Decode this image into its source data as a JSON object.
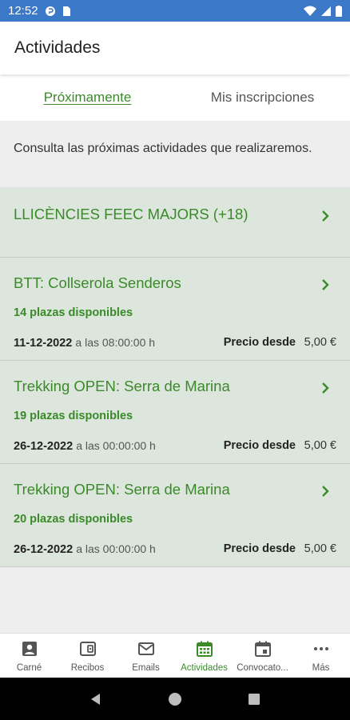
{
  "status": {
    "time": "12:52"
  },
  "app_bar": {
    "title": "Actividades"
  },
  "tabs": [
    {
      "label": "Próximamente",
      "active": true
    },
    {
      "label": "Mis inscripciones",
      "active": false
    }
  ],
  "intro_text": "Consulta las próximas actividades que realizaremos.",
  "items": [
    {
      "title": "LLICÈNCIES FEEC MAJORS (+18)"
    },
    {
      "title": "BTT: Collserola Senderos",
      "plazas": "14 plazas disponibles",
      "date": "11-12-2022",
      "time": "a las 08:00:00 h",
      "price_label": "Precio desde",
      "price": "5,00 €"
    },
    {
      "title": "Trekking OPEN: Serra de Marina",
      "plazas": "19 plazas disponibles",
      "date": "26-12-2022",
      "time": "a las 00:00:00 h",
      "price_label": "Precio desde",
      "price": "5,00 €"
    },
    {
      "title": "Trekking OPEN: Serra de Marina",
      "plazas": "20 plazas disponibles",
      "date": "26-12-2022",
      "time": "a las 00:00:00 h",
      "price_label": "Precio desde",
      "price": "5,00 €"
    }
  ],
  "bottom_nav": [
    {
      "label": "Carné",
      "icon": "id-card-icon"
    },
    {
      "label": "Recibos",
      "icon": "receipt-icon"
    },
    {
      "label": "Emails",
      "icon": "mail-icon"
    },
    {
      "label": "Actividades",
      "icon": "calendar-grid-icon",
      "active": true
    },
    {
      "label": "Convocato...",
      "icon": "calendar-event-icon"
    },
    {
      "label": "Más",
      "icon": "more-dots-icon"
    }
  ],
  "colors": {
    "accent": "#3a8a2a",
    "status_bar": "#3b78c7",
    "item_bg": "#dde6dc",
    "content_bg": "#eeeeee"
  }
}
